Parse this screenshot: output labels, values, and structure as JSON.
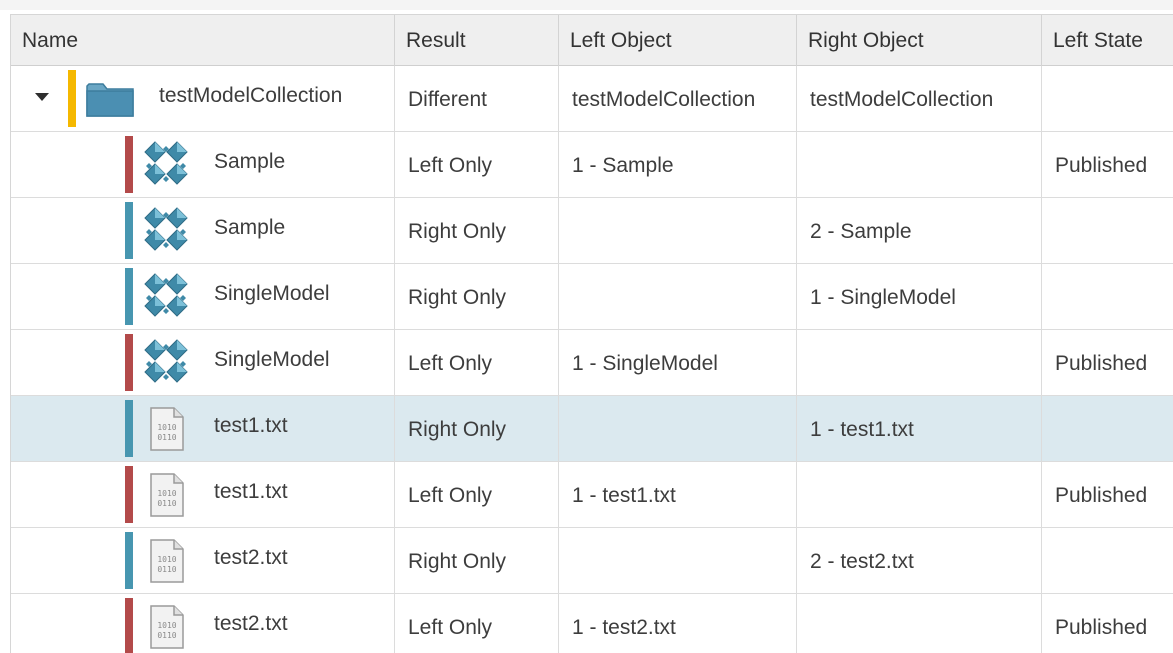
{
  "columns": {
    "name": "Name",
    "result": "Result",
    "left_object": "Left Object",
    "right_object": "Right Object",
    "left_state": "Left State"
  },
  "colors": {
    "collection_bar": "#f5b800",
    "left_only_bar": "#b34a4a",
    "right_only_bar": "#4796b0",
    "selected_row": "#dbe9ef"
  },
  "rows": [
    {
      "name": "testModelCollection",
      "icon": "folder-icon",
      "bar": "collection",
      "result": "Different",
      "left_object": "testModelCollection",
      "right_object": "testModelCollection",
      "left_state": ""
    },
    {
      "name": "Sample",
      "icon": "model-icon",
      "bar": "left",
      "result": "Left Only",
      "left_object": "1 - Sample",
      "right_object": "",
      "left_state": "Published"
    },
    {
      "name": "Sample",
      "icon": "model-icon",
      "bar": "right",
      "result": "Right Only",
      "left_object": "",
      "right_object": "2 - Sample",
      "left_state": ""
    },
    {
      "name": "SingleModel",
      "icon": "model-icon",
      "bar": "right",
      "result": "Right Only",
      "left_object": "",
      "right_object": "1 - SingleModel",
      "left_state": ""
    },
    {
      "name": "SingleModel",
      "icon": "model-icon",
      "bar": "left",
      "result": "Left Only",
      "left_object": "1 - SingleModel",
      "right_object": "",
      "left_state": "Published"
    },
    {
      "name": "test1.txt",
      "icon": "binary-file-icon",
      "bar": "right",
      "result": "Right Only",
      "left_object": "",
      "right_object": "1 - test1.txt",
      "left_state": "",
      "selected": true
    },
    {
      "name": "test1.txt",
      "icon": "binary-file-icon",
      "bar": "left",
      "result": "Left Only",
      "left_object": "1 - test1.txt",
      "right_object": "",
      "left_state": "Published"
    },
    {
      "name": "test2.txt",
      "icon": "binary-file-icon",
      "bar": "right",
      "result": "Right Only",
      "left_object": "",
      "right_object": "2 - test2.txt",
      "left_state": ""
    },
    {
      "name": "test2.txt",
      "icon": "binary-file-icon",
      "bar": "left",
      "result": "Left Only",
      "left_object": "1 - test2.txt",
      "right_object": "",
      "left_state": "Published"
    }
  ]
}
